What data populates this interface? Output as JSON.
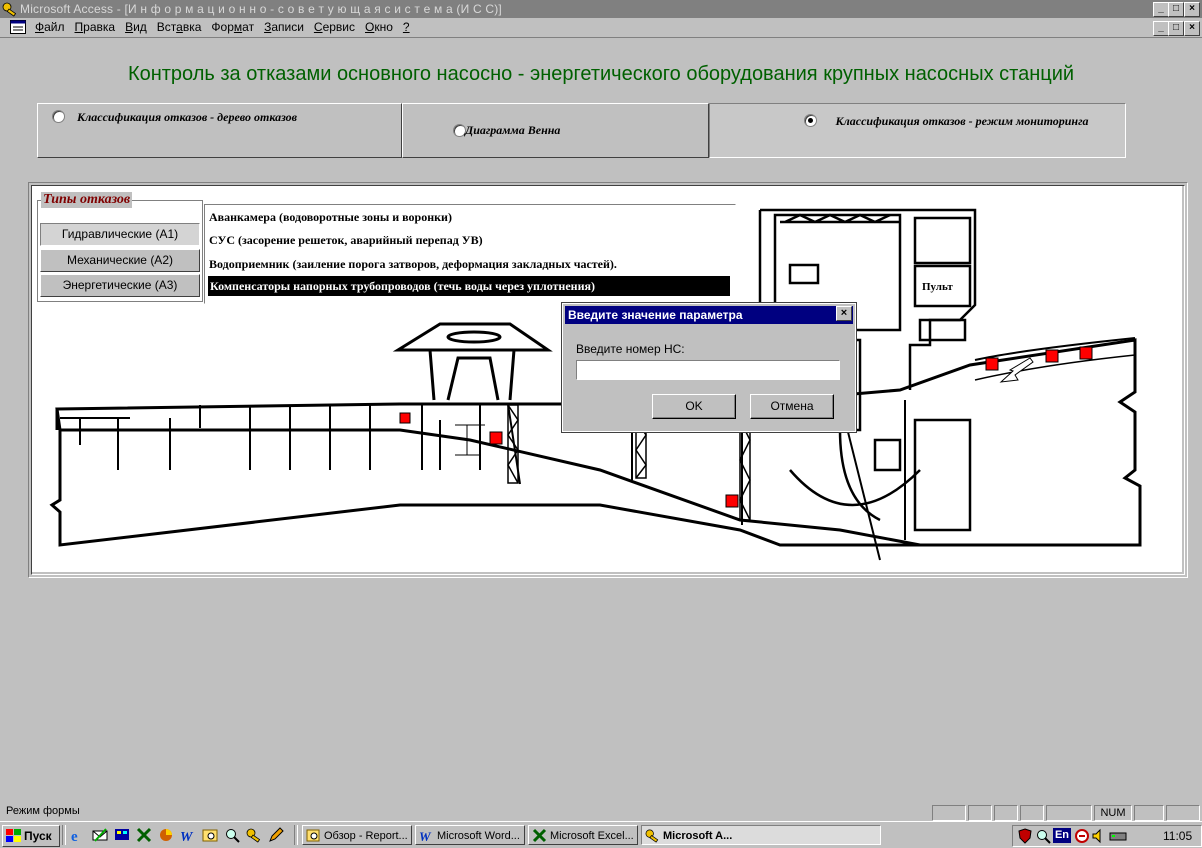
{
  "window": {
    "title": "Microsoft Access - [И н ф о р м а ц и о н н о - с о в е т у ю щ а я   с и с т е м а  (И С С)]",
    "controls": [
      "_",
      "□",
      "×"
    ]
  },
  "menu": {
    "items": [
      {
        "pre": "",
        "u": "Ф",
        "post": "айл"
      },
      {
        "pre": "",
        "u": "П",
        "post": "равка"
      },
      {
        "pre": "",
        "u": "В",
        "post": "ид"
      },
      {
        "pre": "Вст",
        "u": "а",
        "post": "вка"
      },
      {
        "pre": "Фор",
        "u": "м",
        "post": "ат"
      },
      {
        "pre": "",
        "u": "З",
        "post": "аписи"
      },
      {
        "pre": "",
        "u": "С",
        "post": "ервис"
      },
      {
        "pre": "",
        "u": "О",
        "post": "кно"
      },
      {
        "pre": "",
        "u": "?",
        "post": ""
      }
    ]
  },
  "form": {
    "title": "Контроль за отказами основного насосно - энергетического оборудования крупных насосных станций",
    "options": [
      {
        "label": "Классификация отказов - дерево отказов",
        "selected": false
      },
      {
        "label": "Диаграмма Венна",
        "selected": false
      },
      {
        "label": "Классификация отказов - режим мониторинга",
        "selected": true
      }
    ],
    "types_legend": "Типы отказов",
    "types": [
      "Гидравлические (А1)",
      "Механические (А2)",
      "Энергетические (А3)"
    ],
    "failures": [
      "Аванкамера (водоворотные зоны и воронки)",
      "СУС (засорение решеток, аварийный перепад УВ)",
      "Водоприемник (заиление порога затворов, деформация закладных частей).",
      "Компенсаторы напорных трубопроводов (течь воды через уплотнения)"
    ],
    "selected_failure": 3,
    "diagram": {
      "panel_label": "Пульт",
      "marker_color": "#ff0000"
    }
  },
  "dialog": {
    "title": "Введите значение параметра",
    "prompt": "Введите номер НС:",
    "input_value": "",
    "ok": "OK",
    "cancel": "Отмена"
  },
  "status": {
    "text": "Режим формы",
    "num": "NUM"
  },
  "taskbar": {
    "start": "Пуск",
    "buttons": [
      {
        "label": "Обзор - Report...",
        "active": false
      },
      {
        "label": "Microsoft Word...",
        "active": false
      },
      {
        "label": "Microsoft Excel...",
        "active": false
      },
      {
        "label": "Microsoft A...",
        "active": true
      }
    ],
    "lang": "En",
    "clock": "11:05"
  }
}
